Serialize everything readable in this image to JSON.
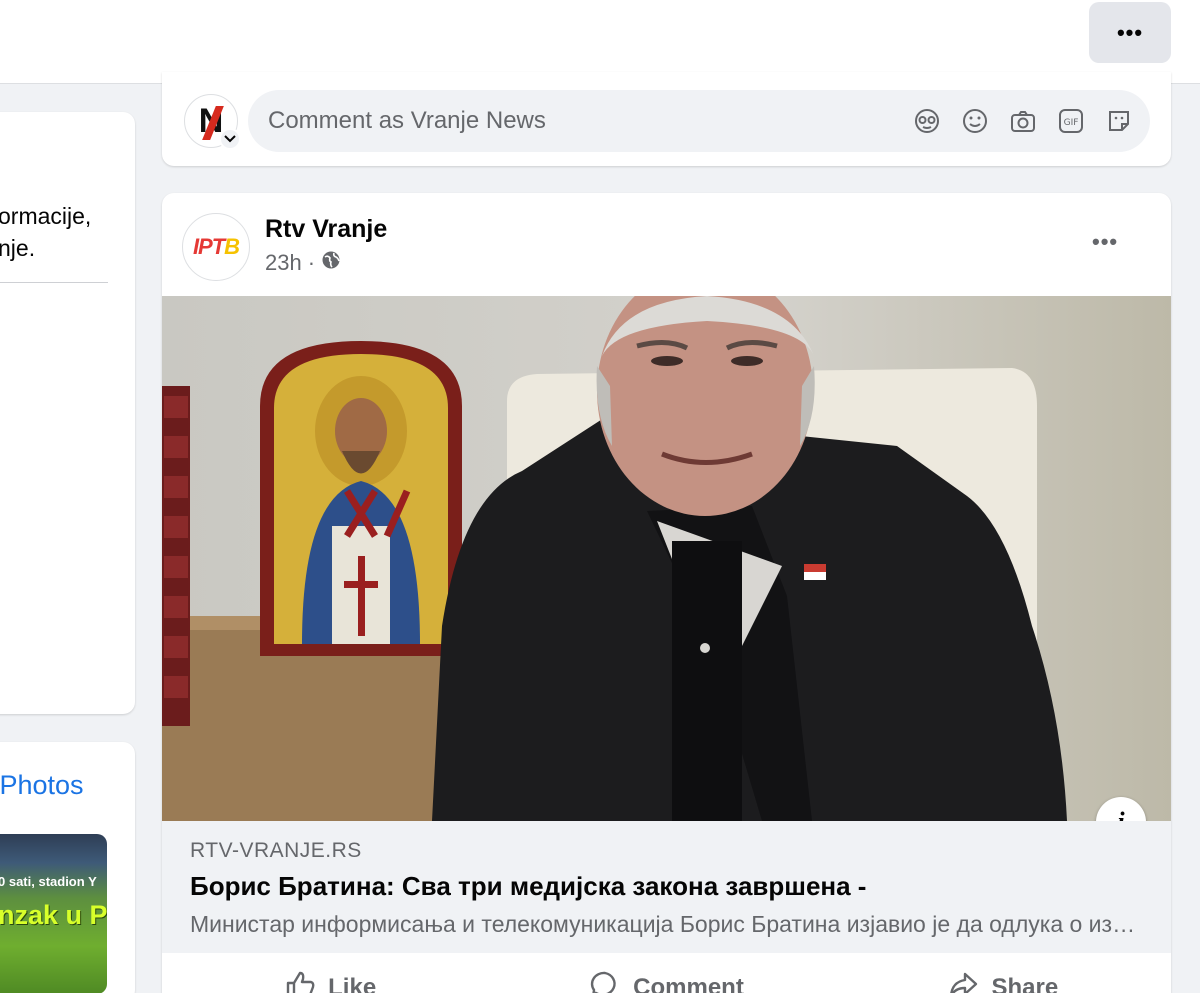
{
  "topbar": {
    "more_label": "•••"
  },
  "left_panel": {
    "intro_line1": "ormacije,",
    "intro_line2": "nje.",
    "see_all_photos": "ll Photos",
    "photo_caption_small": "0 sati, stadion Y",
    "photo_caption_big": "nzak u Pr"
  },
  "composer": {
    "placeholder": "Comment as Vranje News",
    "avatar_letter": "N",
    "icons": [
      "avatar-sticker-icon",
      "emoji-icon",
      "camera-icon",
      "gif-icon",
      "sticker-icon"
    ]
  },
  "post": {
    "author": "Rtv Vranje",
    "time": "23h",
    "separator": "·",
    "more_label": "•••",
    "avatar_logo": {
      "a": "IPT",
      "b": "B"
    },
    "image_info": "i",
    "link": {
      "domain": "RTV-VRANJE.RS",
      "title": "Борис Братина: Сва три медијска закона завршена -",
      "description": "Министар информисања и телекомуникација Борис Братина изјавио је да одлука о измени сва три медијска закона"
    },
    "actions": [
      {
        "label": "Like",
        "icon": "like-icon"
      },
      {
        "label": "Comment",
        "icon": "comment-icon"
      },
      {
        "label": "Share",
        "icon": "share-icon"
      }
    ]
  },
  "colors": {
    "accent": "#1b74e4",
    "background": "#f0f2f5",
    "secondary_text": "#65676b"
  }
}
